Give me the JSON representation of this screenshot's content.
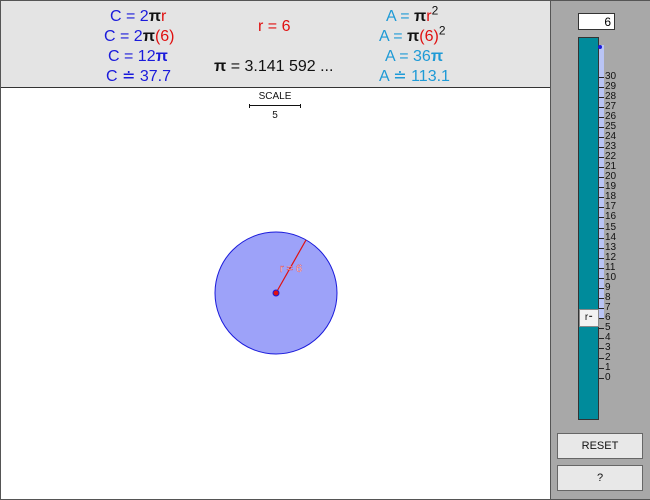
{
  "header": {
    "circumference": {
      "line1": {
        "prefix": "C = 2",
        "pi": "π",
        "var": "r"
      },
      "line2": {
        "prefix": "C = 2",
        "pi": "π",
        "value": "(6)"
      },
      "line3": {
        "prefix": "C = 12",
        "pi": "π"
      },
      "line4": {
        "text": "C ≐ 37.7"
      }
    },
    "radius_display": "r = 6",
    "pi_display": {
      "pi": "π",
      "text": " = 3.141 592 ..."
    },
    "area": {
      "line1": {
        "prefix": "A = ",
        "pi": "π",
        "var": "r",
        "exp": "2"
      },
      "line2": {
        "prefix": "A = ",
        "pi": "π",
        "value": "(6)",
        "exp": "2"
      },
      "line3": {
        "prefix": "A = 36",
        "pi": "π"
      },
      "line4": {
        "text": "A ≐ 113.1"
      }
    }
  },
  "scale": {
    "label": "SCALE",
    "value": "5"
  },
  "circle": {
    "radius_label": "r = 6",
    "radius": 6,
    "fill": "#9da2f9",
    "stroke": "#1a1adb",
    "radius_color": "#e01010"
  },
  "slider": {
    "input_value": "6",
    "handle_label": "r",
    "value": 6,
    "min": 0,
    "max": 30,
    "ticks": [
      "30",
      "29",
      "28",
      "27",
      "26",
      "25",
      "24",
      "23",
      "22",
      "21",
      "20",
      "19",
      "18",
      "17",
      "16",
      "15",
      "14",
      "13",
      "12",
      "11",
      "10",
      "9",
      "8",
      "7",
      "6",
      "5",
      "4",
      "3",
      "2",
      "1",
      "0"
    ]
  },
  "buttons": {
    "reset": "RESET",
    "help": "?"
  },
  "colors": {
    "blue": "#1a1adb",
    "cyan": "#1e9ad6",
    "red": "#e01010",
    "track": "#008b9b"
  }
}
